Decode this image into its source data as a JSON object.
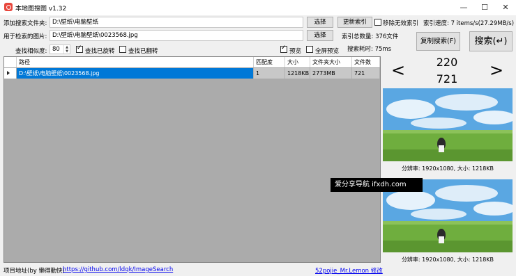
{
  "window": {
    "title": "本地图搜图 v1.32",
    "minimize": "—",
    "maximize": "☐",
    "close": "✕"
  },
  "form": {
    "add_folder_label": "添加搜索文件夹:",
    "add_folder_value": "D:\\壁纸\\电脑壁纸",
    "select_button_1": "选择",
    "update_index_button": "更新索引",
    "remove_invalid_label": "移除无效索引",
    "index_speed_label": "索引速度: 7 items/s(27.29MB/s)",
    "query_image_label": "用于检索的图片:",
    "query_image_value": "D:\\壁纸\\电脑壁纸\\0023568.jpg",
    "select_button_2": "选择",
    "index_total_label": "索引总数量: 376文件",
    "similarity_label": "查找相似度:",
    "similarity_value": "80",
    "find_rotated_label": "查找已旋转",
    "find_flipped_label": "查找已翻转",
    "preview_label": "预览",
    "fullscreen_preview_label": "全屏预览",
    "search_time_label": "搜索耗时: 75ms",
    "copy_search_button": "复制搜索(F)",
    "search_button": "搜索(↵)"
  },
  "table": {
    "columns": [
      "路径",
      "匹配度",
      "大小",
      "文件夹大小",
      "文件数"
    ],
    "rows": [
      {
        "path": "D:\\壁纸\\电脑壁纸\\0023568.jpg",
        "match": "1",
        "size": "1218KB",
        "folder_size": "2773MB",
        "file_count": "721"
      }
    ]
  },
  "preview": {
    "prev": "<",
    "next": ">",
    "width_value": "220",
    "height_value": "721",
    "caption_1": "分辨率: 1920x1080, 大小: 1218KB",
    "caption_2": "分辨率: 1920x1080, 大小: 1218KB"
  },
  "footer": {
    "project_label": "项目地址(by 懒得勤快):",
    "project_link": "https://github.com/ldqk/ImageSearch",
    "modder": "52pojie_Mr.Lemon 修改"
  },
  "watermark": "爱分享导航 ifxdh.com",
  "colors": {
    "selection": "#0078d7",
    "grid_bg": "#ababab",
    "window_bg": "#f0f0f0",
    "sky": "#5aa7e2",
    "grass": "#6fae3e"
  }
}
